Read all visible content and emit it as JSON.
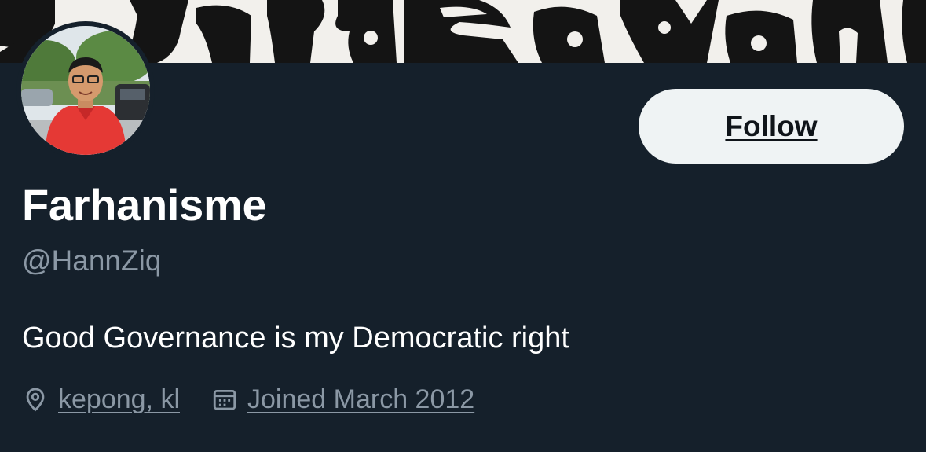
{
  "profile": {
    "display_name": "Farhanisme",
    "handle": "@HannZiq",
    "bio": "Good Governance is my Democratic right",
    "location": "kepong, kl",
    "joined": "Joined March 2012",
    "follow_label": "Follow"
  },
  "icons": {
    "location": "location-pin-icon",
    "calendar": "calendar-icon"
  },
  "colors": {
    "background": "#15202b",
    "secondary_text": "#8b98a5",
    "button_bg": "#eff3f4"
  }
}
